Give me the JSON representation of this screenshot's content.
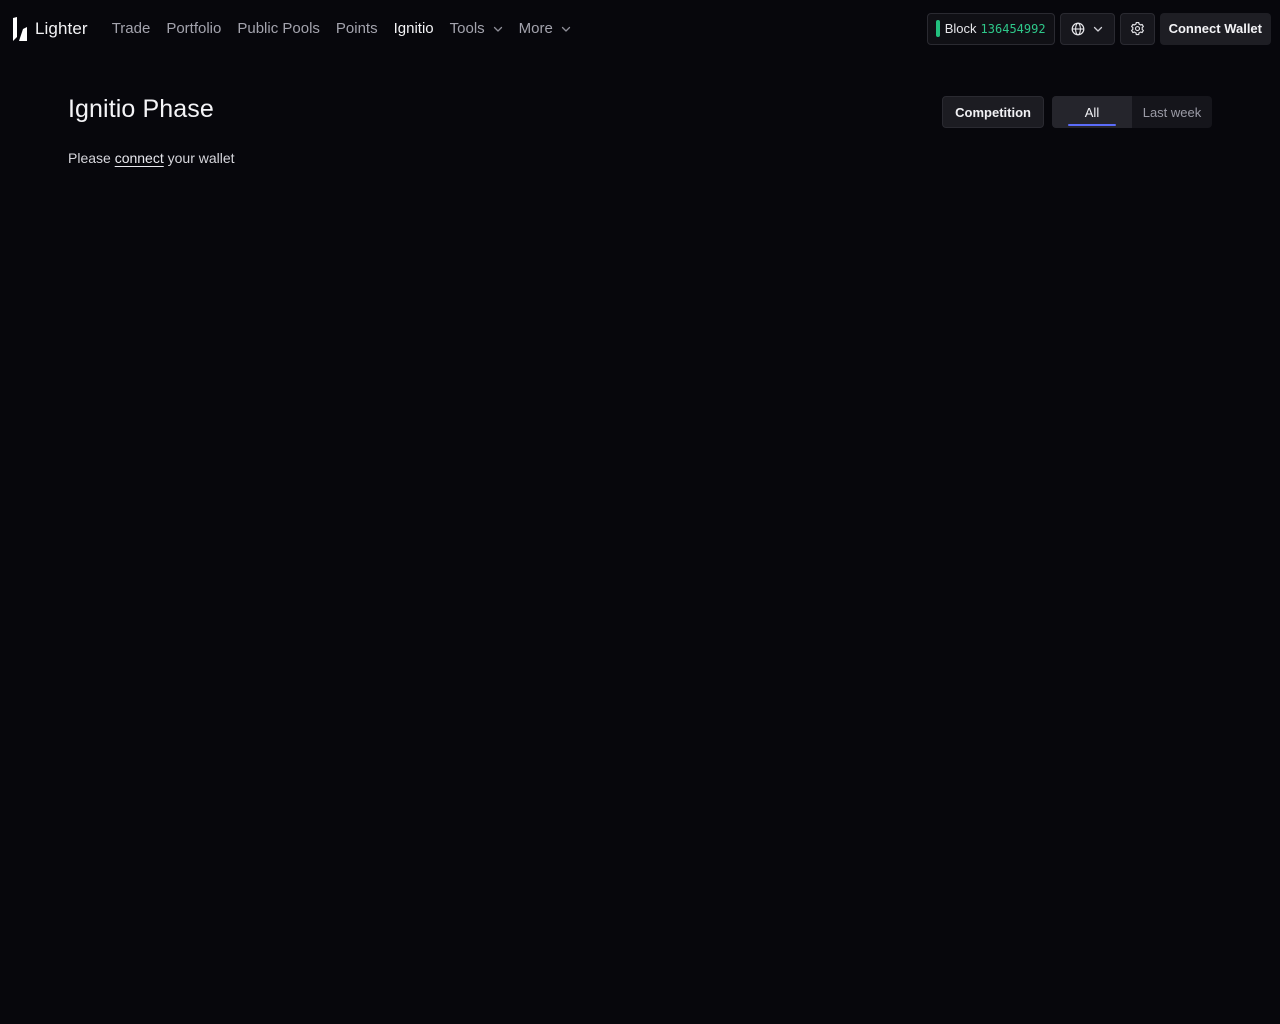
{
  "brand": {
    "name": "Lighter",
    "logo_icon": "lighter-logo-icon"
  },
  "nav": {
    "items": [
      {
        "label": "Trade",
        "active": false
      },
      {
        "label": "Portfolio",
        "active": false
      },
      {
        "label": "Public Pools",
        "active": false
      },
      {
        "label": "Points",
        "active": false
      },
      {
        "label": "Ignitio",
        "active": true
      },
      {
        "label": "Tools",
        "dropdown": true,
        "icon": "chevron-down-icon"
      },
      {
        "label": "More",
        "dropdown": true,
        "icon": "chevron-down-icon"
      }
    ]
  },
  "status": {
    "block_label": "Block",
    "block_number": "136454992",
    "indicator_color": "#22c07e"
  },
  "toolbar": {
    "language_icon": "globe-icon",
    "settings_icon": "gear-icon",
    "connect_label": "Connect Wallet"
  },
  "page": {
    "title": "Ignitio Phase",
    "competition_label": "Competition",
    "tabs": [
      {
        "label": "All",
        "selected": true
      },
      {
        "label": "Last week",
        "selected": false
      }
    ],
    "accent_color": "#5b6cf9",
    "message": {
      "prefix": "Please",
      "link": "connect",
      "suffix": "your wallet"
    }
  }
}
